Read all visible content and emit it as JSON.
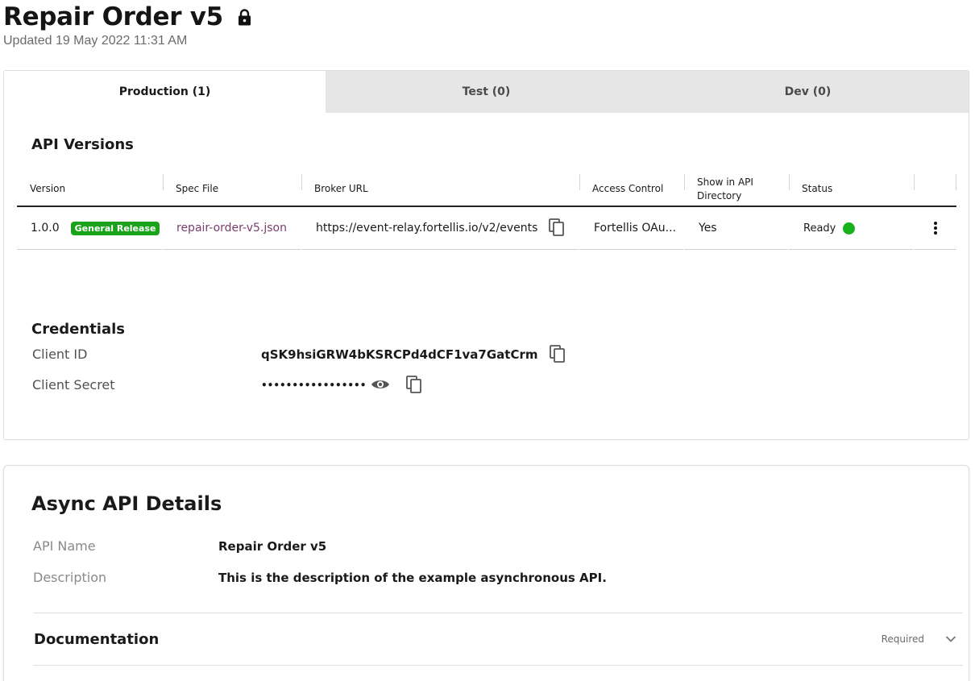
{
  "header": {
    "title": "Repair Order v5",
    "updated": "Updated 19 May 2022 11:31 AM",
    "lock_icon": "lock-icon"
  },
  "tabs": [
    {
      "label": "Production (1)",
      "active": true
    },
    {
      "label": "Test (0)",
      "active": false
    },
    {
      "label": "Dev (0)",
      "active": false
    }
  ],
  "api_versions": {
    "title": "API Versions",
    "columns": [
      "Version",
      "Spec File",
      "Broker URL",
      "Access Control",
      "Show in API Directory",
      "Status"
    ],
    "rows": [
      {
        "version": "1.0.0",
        "badge": "General Release",
        "spec_file": "repair-order-v5.json",
        "broker_url": "https://event-relay.fortellis.io/v2/events",
        "access_control": "Fortellis OAu...",
        "show_in_directory": "Yes",
        "status": "Ready",
        "status_color": "#19b01e"
      }
    ]
  },
  "credentials": {
    "title": "Credentials",
    "client_id_label": "Client ID",
    "client_id": "qSK9hsiGRW4bKSRCPd4dCF1va7GatCrm",
    "client_secret_label": "Client Secret",
    "client_secret_masked": "•••••••••••••••••"
  },
  "details": {
    "title": "Async API Details",
    "api_name_label": "API Name",
    "api_name": "Repair Order v5",
    "description_label": "Description",
    "description": "This is the description of the example asynchronous API.",
    "documentation_title": "Documentation",
    "documentation_required": "Required"
  },
  "colors": {
    "badge_green": "#1aa31a",
    "link_purple": "#7a3d6e",
    "tab_inactive_bg": "#e6e6e6"
  }
}
